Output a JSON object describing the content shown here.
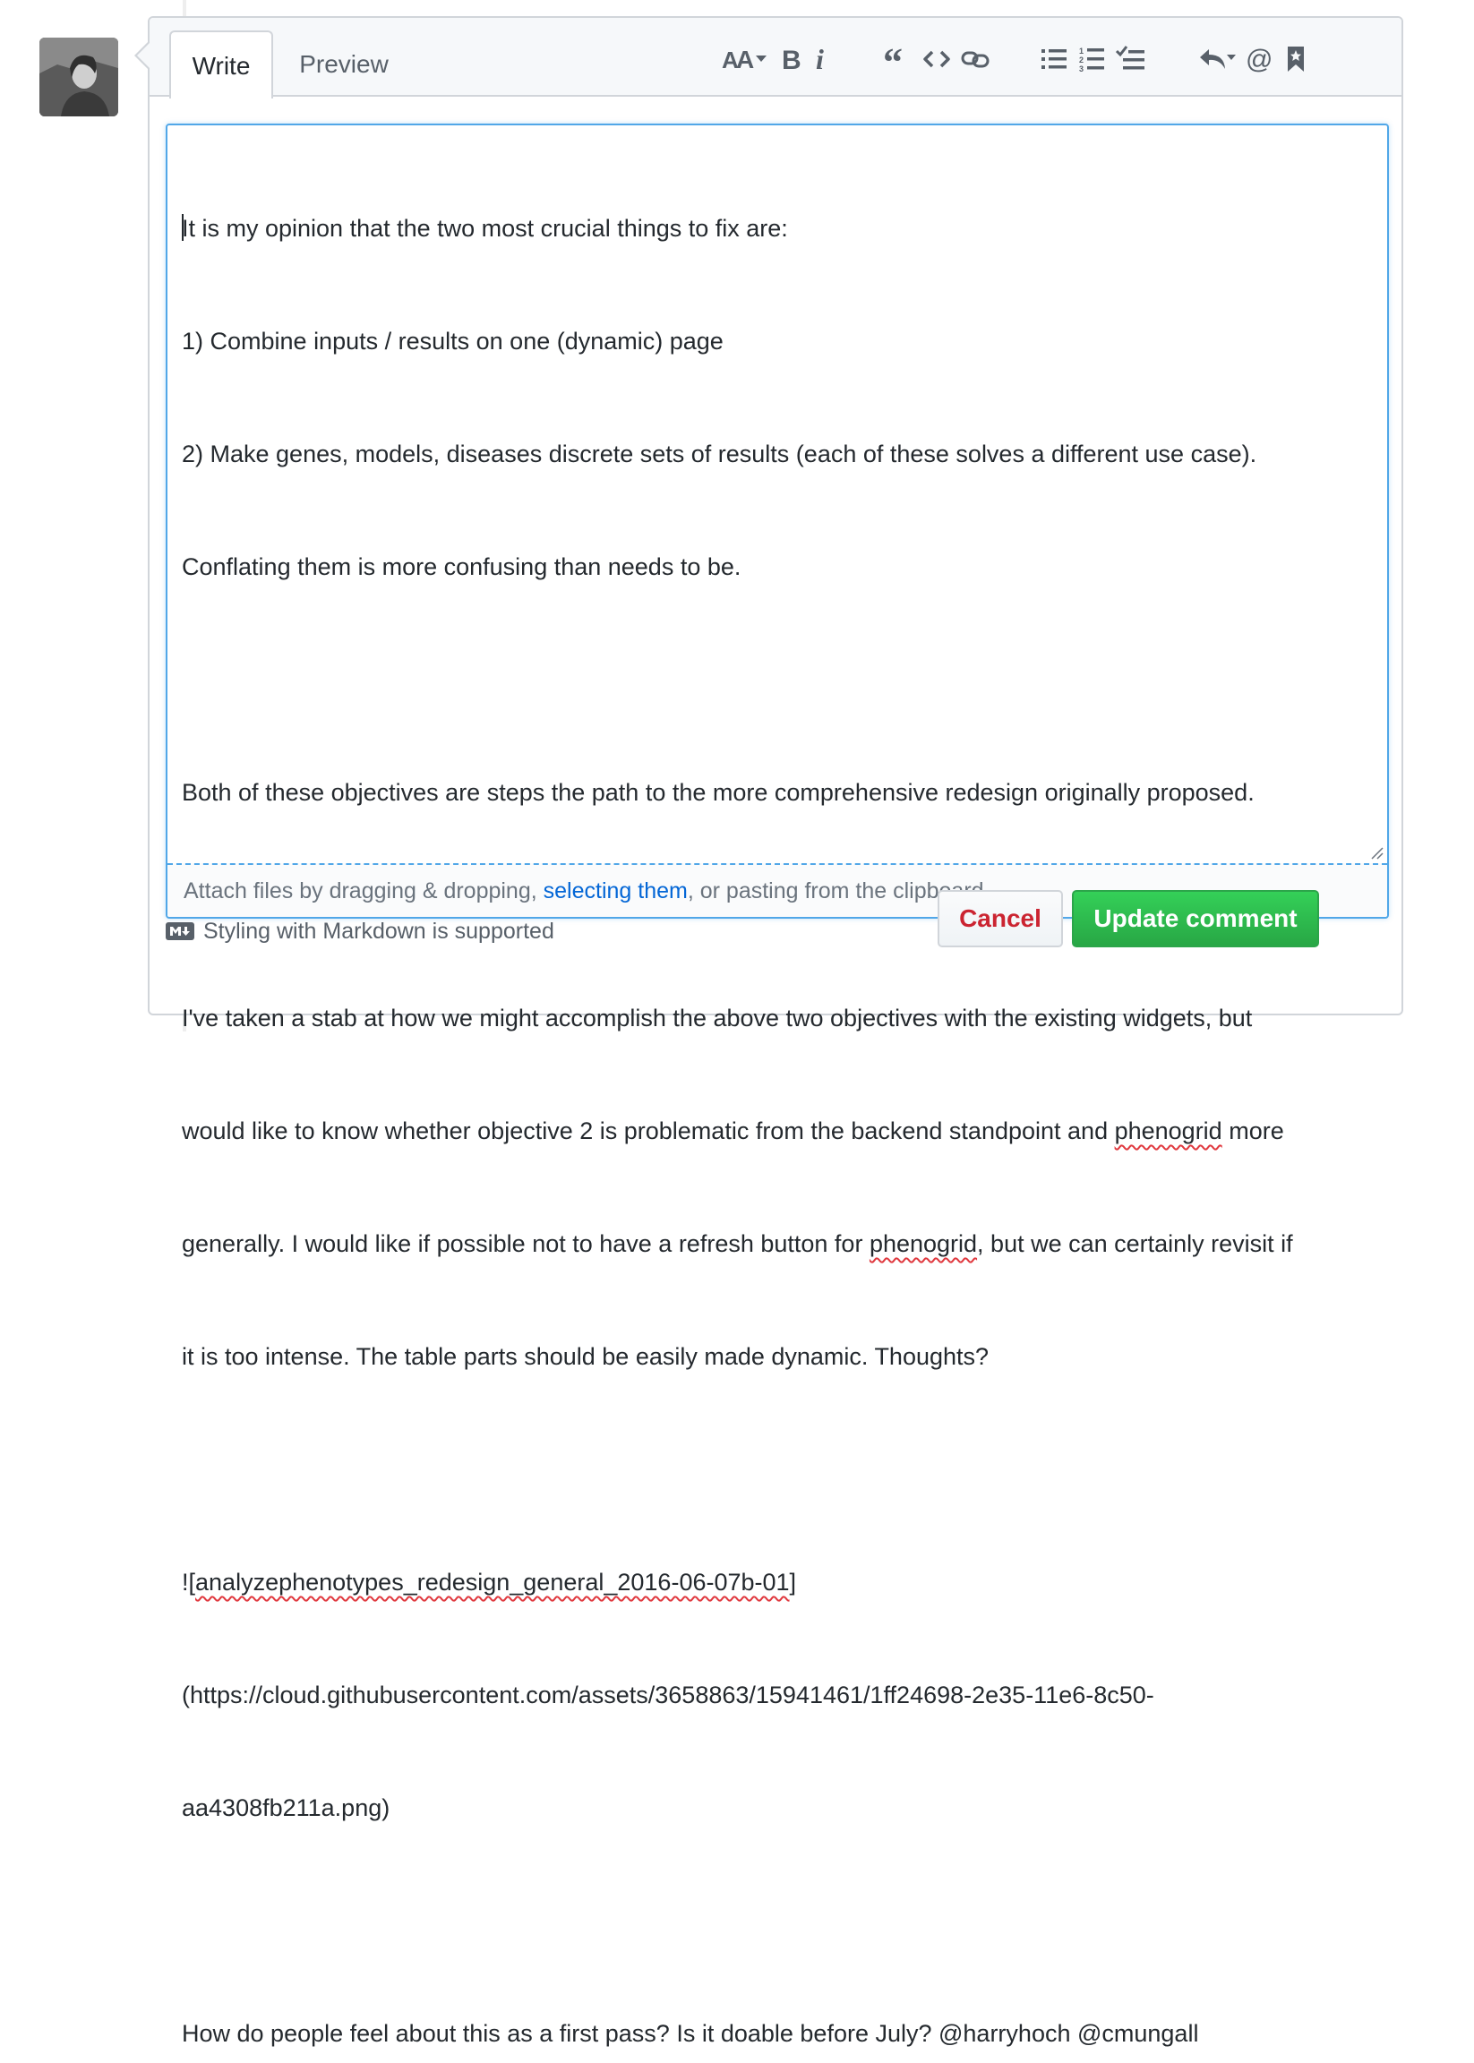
{
  "tabs": {
    "write": "Write",
    "preview": "Preview"
  },
  "toolbar": {
    "buttons": [
      {
        "name": "header-text",
        "icon": "text-size-icon"
      },
      {
        "name": "bold",
        "icon": "bold-icon"
      },
      {
        "name": "italic",
        "icon": "italic-icon"
      },
      {
        "name": "quote",
        "icon": "quote-icon"
      },
      {
        "name": "code",
        "icon": "code-icon"
      },
      {
        "name": "link",
        "icon": "link-icon"
      },
      {
        "name": "bulleted-list",
        "icon": "list-unordered-icon"
      },
      {
        "name": "numbered-list",
        "icon": "list-ordered-icon"
      },
      {
        "name": "task-list",
        "icon": "tasklist-icon"
      },
      {
        "name": "saved-replies",
        "icon": "reply-icon"
      },
      {
        "name": "mention",
        "icon": "mention-icon"
      },
      {
        "name": "reference",
        "icon": "bookmark-icon"
      }
    ]
  },
  "editor": {
    "lines": [
      "It is my opinion that the two most crucial things to fix are:",
      "1) Combine inputs / results on one (dynamic) page",
      "2) Make genes, models, diseases discrete sets of results (each of these solves a different use case).",
      "Conflating them is more confusing than needs to be.",
      "",
      "Both of these objectives are steps the path to the more comprehensive redesign originally proposed.",
      "",
      "I've taken a stab at how we might accomplish the above two objectives with the existing widgets, but",
      "would like to know whether objective 2 is problematic from the backend standpoint and ",
      "phenogrid",
      " more",
      "generally. I would like if possible not to have a refresh button for ",
      "phenogrid",
      ", but we can certainly revisit if",
      "it is too intense. The table parts should be easily made dynamic. Thoughts?",
      "",
      "![",
      "analyzephenotypes_redesign_general_2016-06-07b-01",
      "]",
      "(https://cloud.githubusercontent.com/assets/3658863/15941461/1ff24698-2e35-11e6-8c50-",
      "aa4308fb211a.png)",
      "",
      "How do people feel about this as a first pass? Is it doable before July? @harryhoch @cmungall"
    ]
  },
  "dropzone": {
    "prefix": "Attach files by dragging & dropping, ",
    "link": "selecting them",
    "suffix": ", or pasting from the clipboard."
  },
  "footer": {
    "markdown_note": "Styling with Markdown is supported",
    "cancel_label": "Cancel",
    "update_label": "Update comment"
  },
  "colors": {
    "accent_blue": "#51a7e8",
    "link_blue": "#0366d6",
    "cancel_red": "#cb2431",
    "update_green": "#28a745"
  }
}
